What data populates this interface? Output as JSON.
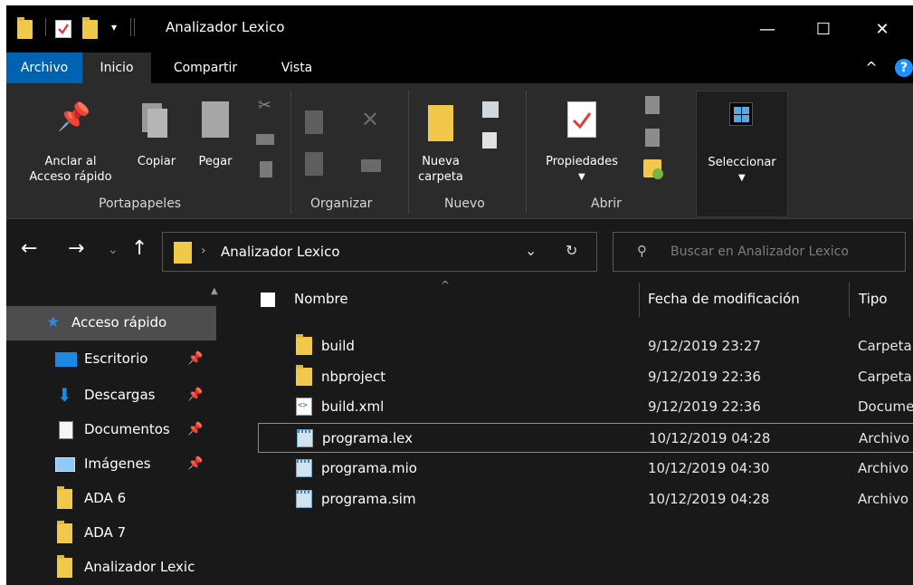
{
  "window": {
    "title": "Analizador Lexico",
    "minimize": "—",
    "maximize": "☐",
    "close": "✕"
  },
  "menu": {
    "tabs": [
      "Archivo",
      "Inicio",
      "Compartir",
      "Vista"
    ],
    "collapse": "^",
    "help": "?"
  },
  "ribbon": {
    "portapapeles": {
      "label": "Portapapeles",
      "pin_line1": "Anclar al",
      "pin_line2": "Acceso rápido",
      "copy": "Copiar",
      "paste": "Pegar"
    },
    "organizar": {
      "label": "Organizar"
    },
    "nuevo": {
      "label": "Nuevo",
      "new_folder_line1": "Nueva",
      "new_folder_line2": "carpeta"
    },
    "abrir": {
      "label": "Abrir",
      "properties": "Propiedades"
    },
    "seleccionar": {
      "label": "Seleccionar"
    }
  },
  "address": {
    "path": "Analizador Lexico",
    "search_placeholder": "Buscar en Analizador Lexico"
  },
  "sidebar": {
    "items": [
      {
        "label": "Acceso rápido",
        "icon": "star-icon",
        "pinned": false
      },
      {
        "label": "Escritorio",
        "icon": "desktop-icon",
        "pinned": true
      },
      {
        "label": "Descargas",
        "icon": "download-icon",
        "pinned": true
      },
      {
        "label": "Documentos",
        "icon": "documents-icon",
        "pinned": true
      },
      {
        "label": "Imágenes",
        "icon": "pictures-icon",
        "pinned": true
      },
      {
        "label": "ADA 6",
        "icon": "folder-icon",
        "pinned": false
      },
      {
        "label": "ADA 7",
        "icon": "folder-icon",
        "pinned": false
      },
      {
        "label": "Analizador Lexic",
        "icon": "folder-icon",
        "pinned": false
      }
    ]
  },
  "filelist": {
    "columns": {
      "name": "Nombre",
      "modified": "Fecha de modificación",
      "type": "Tipo"
    },
    "rows": [
      {
        "name": "build",
        "modified": "9/12/2019 23:27",
        "type": "Carpeta",
        "icon": "folder-icon"
      },
      {
        "name": "nbproject",
        "modified": "9/12/2019 22:36",
        "type": "Carpeta",
        "icon": "folder-icon"
      },
      {
        "name": "build.xml",
        "modified": "9/12/2019 22:36",
        "type": "Documento",
        "icon": "xml-file-icon"
      },
      {
        "name": "programa.lex",
        "modified": "10/12/2019 04:28",
        "type": "Archivo",
        "icon": "text-file-icon"
      },
      {
        "name": "programa.mio",
        "modified": "10/12/2019 04:30",
        "type": "Archivo",
        "icon": "text-file-icon"
      },
      {
        "name": "programa.sim",
        "modified": "10/12/2019 04:28",
        "type": "Archivo",
        "icon": "text-file-icon"
      }
    ]
  },
  "colors": {
    "accent": "#0063b1",
    "background": "#191919",
    "ribbon": "#2b2b2b",
    "folder": "#f2c84b"
  }
}
